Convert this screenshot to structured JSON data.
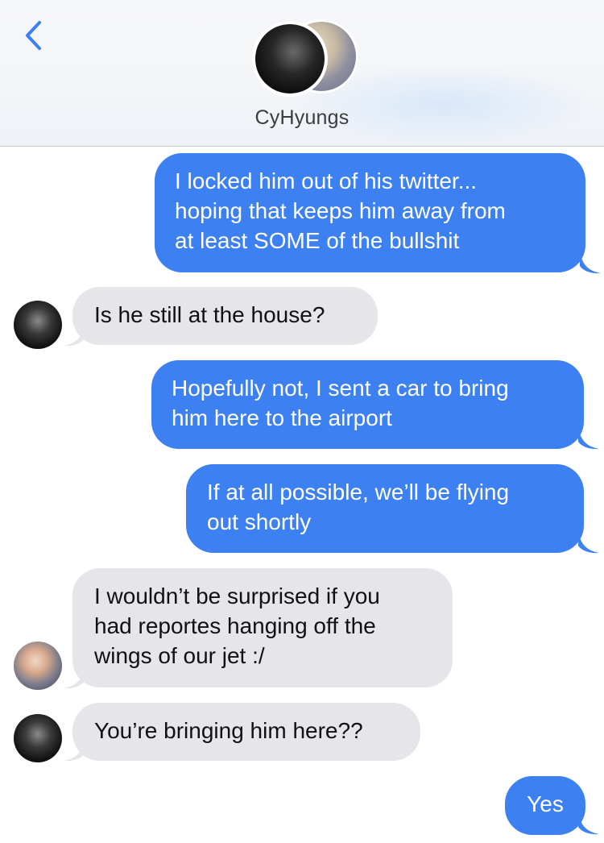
{
  "header": {
    "title": "CyHyungs"
  },
  "messages": [
    {
      "side": "out",
      "text": "I locked him out of his twitter...\nhoping that keeps him away from\nat least SOME of the bullshit"
    },
    {
      "side": "in",
      "text": "Is he still at the house?"
    },
    {
      "side": "out",
      "text": "Hopefully not, I sent a car to bring\nhim here to the airport"
    },
    {
      "side": "out",
      "text": "If at all possible, we’ll be flying\nout shortly"
    },
    {
      "side": "in",
      "text": "I wouldn’t be surprised if you\nhad reportes hanging off the\nwings of our jet :/"
    },
    {
      "side": "in",
      "text": "You’re bringing him here??"
    },
    {
      "side": "out",
      "text": "Yes"
    }
  ],
  "colors": {
    "outgoing_bubble": "#3d80f1",
    "incoming_bubble": "#e5e5ea",
    "back_chevron": "#3d80f1"
  }
}
